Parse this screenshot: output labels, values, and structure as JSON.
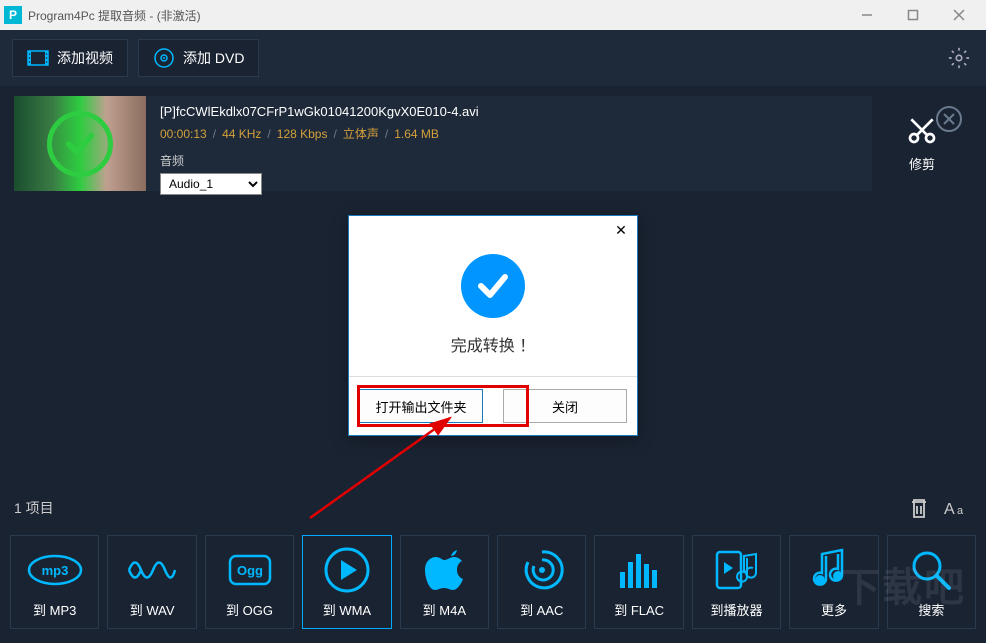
{
  "window": {
    "title": "Program4Pc 提取音频 - (非激活)"
  },
  "toolbar": {
    "add_video": "添加视频",
    "add_dvd": "添加 DVD"
  },
  "file": {
    "name": "[P]fcCWlEkdlx07CFrP1wGk01041200KgvX0E010-4.avi",
    "duration": "00:00:13",
    "khz": "44 KHz",
    "kbps": "128 Kbps",
    "channels": "立体声",
    "size": "1.64 MB",
    "audio_label": "音频",
    "audio_selected": "Audio_1",
    "cut_label": "修剪"
  },
  "status": {
    "items_text": "1 项目"
  },
  "dialog": {
    "message": "完成转换 ！",
    "open_folder": "打开输出文件夹",
    "close": "关闭"
  },
  "formats": [
    {
      "label": "到 MP3",
      "icon": "mp3",
      "active": false
    },
    {
      "label": "到 WAV",
      "icon": "wav",
      "active": false
    },
    {
      "label": "到 OGG",
      "icon": "ogg",
      "active": false
    },
    {
      "label": "到 WMA",
      "icon": "wma",
      "active": true
    },
    {
      "label": "到 M4A",
      "icon": "m4a",
      "active": false
    },
    {
      "label": "到 AAC",
      "icon": "aac",
      "active": false
    },
    {
      "label": "到 FLAC",
      "icon": "flac",
      "active": false
    },
    {
      "label": "到播放器",
      "icon": "player",
      "active": false
    },
    {
      "label": "更多",
      "icon": "more",
      "active": false
    },
    {
      "label": "搜索",
      "icon": "search",
      "active": false
    }
  ],
  "watermark": "下载吧"
}
